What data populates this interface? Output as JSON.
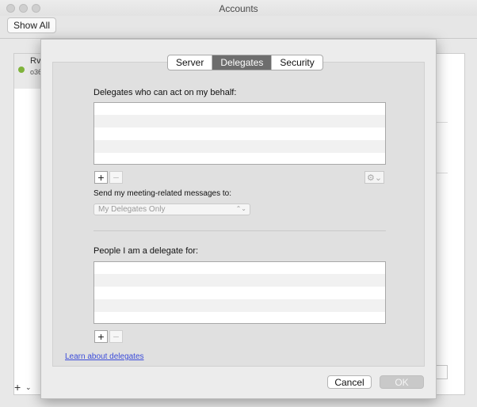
{
  "window": {
    "title": "Accounts"
  },
  "toolbar": {
    "show_all_label": "Show All"
  },
  "background": {
    "account_name": "Rv",
    "account_sub": "o36",
    "add_label": "+",
    "add_menu_caret": "⌄"
  },
  "tabs": [
    {
      "label": "Server",
      "active": false
    },
    {
      "label": "Delegates",
      "active": true
    },
    {
      "label": "Security",
      "active": false
    }
  ],
  "delegates": {
    "heading": "Delegates who can act on my behalf:",
    "add_label": "+",
    "remove_label": "−",
    "gear_label": "⚙⌄",
    "send_label": "Send my meeting-related messages to:",
    "send_selected": "My Delegates Only",
    "send_arrows": "⌃⌄"
  },
  "delegate_for": {
    "heading": "People I am a delegate for:",
    "add_label": "+",
    "remove_label": "−"
  },
  "learn_link": "Learn about delegates",
  "buttons": {
    "cancel": "Cancel",
    "ok": "OK"
  },
  "colors": {
    "active_tab": "#6d6d6d",
    "link": "#3b4bd9",
    "status_dot": "#7fb33b"
  }
}
